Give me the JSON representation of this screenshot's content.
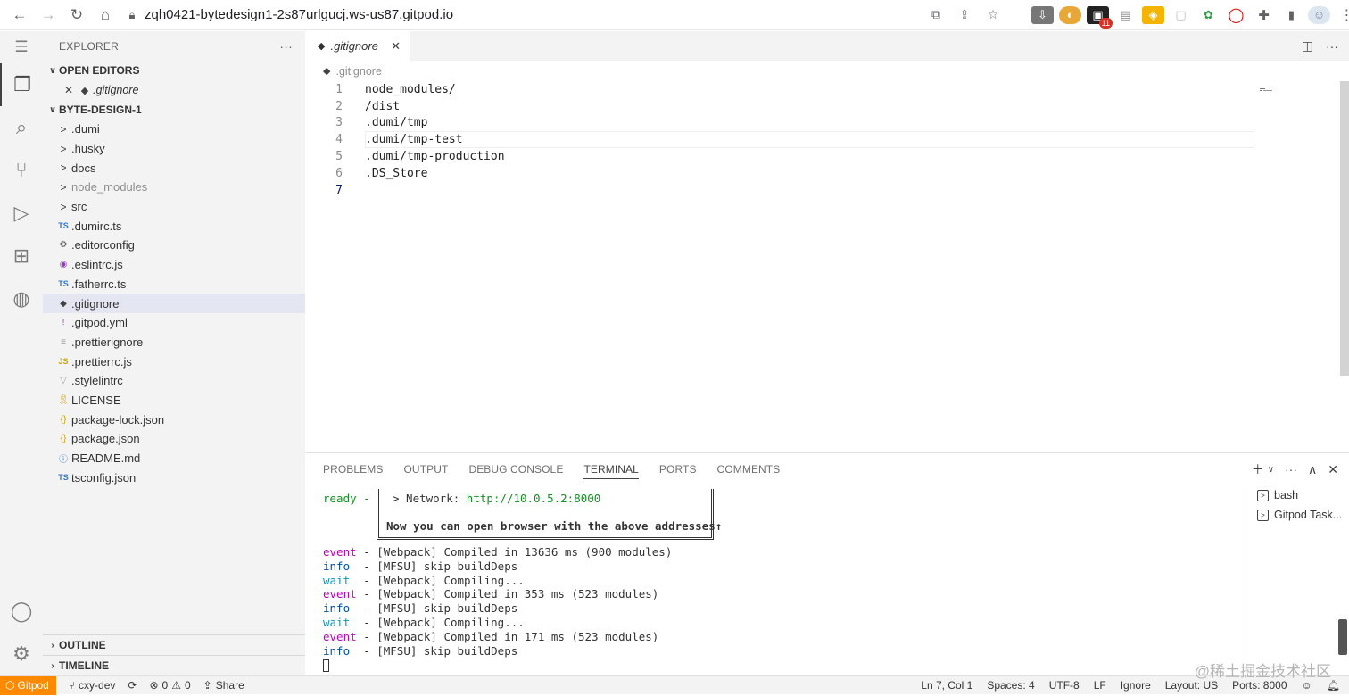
{
  "browser": {
    "url": "zqh0421-bytedesign1-2s87urlgucj.ws-us87.gitpod.io",
    "extension_badge": "11"
  },
  "sidebar": {
    "title": "EXPLORER",
    "more": "···",
    "open_editors_label": "OPEN EDITORS",
    "open_editor_file": ".gitignore",
    "project_label": "BYTE-DESIGN-1",
    "items": [
      {
        "label": ".dumi",
        "icon": ">",
        "type": "folder"
      },
      {
        "label": ".husky",
        "icon": ">",
        "type": "folder"
      },
      {
        "label": "docs",
        "icon": ">",
        "type": "folder"
      },
      {
        "label": "node_modules",
        "icon": ">",
        "type": "folder",
        "dim": true
      },
      {
        "label": "src",
        "icon": ">",
        "type": "folder"
      },
      {
        "label": ".dumirc.ts",
        "icon": "TS",
        "type": "file",
        "color": "#3178c6"
      },
      {
        "label": ".editorconfig",
        "icon": "⚙",
        "type": "file",
        "color": "#555555"
      },
      {
        "label": ".eslintrc.js",
        "icon": "◉",
        "type": "file",
        "color": "#8e44ad"
      },
      {
        "label": ".fatherrc.ts",
        "icon": "TS",
        "type": "file",
        "color": "#3178c6"
      },
      {
        "label": ".gitignore",
        "icon": "◆",
        "type": "file",
        "color": "#424242",
        "selected": true
      },
      {
        "label": ".gitpod.yml",
        "icon": "!",
        "type": "file",
        "color": "#8e44ad"
      },
      {
        "label": ".prettierignore",
        "icon": "≡",
        "type": "file",
        "color": "#9a9a9a"
      },
      {
        "label": ".prettierrc.js",
        "icon": "JS",
        "type": "file",
        "color": "#c9a40a"
      },
      {
        "label": ".stylelintrc",
        "icon": "▽",
        "type": "file",
        "color": "#9a9a9a"
      },
      {
        "label": "LICENSE",
        "icon": "🎗",
        "type": "file",
        "color": "#c9a40a"
      },
      {
        "label": "package-lock.json",
        "icon": "{}",
        "type": "file",
        "color": "#c9a40a"
      },
      {
        "label": "package.json",
        "icon": "{}",
        "type": "file",
        "color": "#c9a40a"
      },
      {
        "label": "README.md",
        "icon": "ⓘ",
        "type": "file",
        "color": "#3178c6"
      },
      {
        "label": "tsconfig.json",
        "icon": "TS",
        "type": "file",
        "color": "#3178c6"
      }
    ],
    "outline_label": "OUTLINE",
    "timeline_label": "TIMELINE"
  },
  "editor": {
    "tab_label": ".gitignore",
    "breadcrumb": ".gitignore",
    "lines": [
      {
        "n": "1",
        "text": "node_modules/"
      },
      {
        "n": "2",
        "text": "/dist"
      },
      {
        "n": "3",
        "text": ".dumi/tmp"
      },
      {
        "n": "4",
        "text": ".dumi/tmp-test"
      },
      {
        "n": "5",
        "text": ".dumi/tmp-production"
      },
      {
        "n": "6",
        "text": ".DS_Store"
      },
      {
        "n": "7",
        "text": ""
      }
    ]
  },
  "panel": {
    "tabs": [
      "PROBLEMS",
      "OUTPUT",
      "DEBUG CONSOLE",
      "TERMINAL",
      "PORTS",
      "COMMENTS"
    ],
    "active_tab": "TERMINAL",
    "box_prefix": "ready - ",
    "box_network_label": "> Network: ",
    "box_network_url": "http://10.0.5.2:8000",
    "box_message": "Now you can open browser with the above addresses↑",
    "log": [
      {
        "level": "event",
        "text": " - [Webpack] Compiled in 13636 ms (900 modules)"
      },
      {
        "level": "info",
        "text": "  - [MFSU] skip buildDeps"
      },
      {
        "level": "wait",
        "text": "  - [Webpack] Compiling..."
      },
      {
        "level": "event",
        "text": " - [Webpack] Compiled in 353 ms (523 modules)"
      },
      {
        "level": "info",
        "text": "  - [MFSU] skip buildDeps"
      },
      {
        "level": "wait",
        "text": "  - [Webpack] Compiling..."
      },
      {
        "level": "event",
        "text": " - [Webpack] Compiled in 171 ms (523 modules)"
      },
      {
        "level": "info",
        "text": "  - [MFSU] skip buildDeps"
      }
    ],
    "terminals": [
      "bash",
      "Gitpod Task..."
    ]
  },
  "status": {
    "gitpod": "Gitpod",
    "branch": "cxy-dev",
    "errors": "0",
    "warnings": "0",
    "share": "Share",
    "position": "Ln 7, Col 1",
    "spaces": "Spaces: 4",
    "encoding": "UTF-8",
    "eol": "LF",
    "ignore": "Ignore",
    "layout": "Layout: US",
    "ports": "Ports: 8000"
  },
  "watermark": "@稀土掘金技术社区"
}
